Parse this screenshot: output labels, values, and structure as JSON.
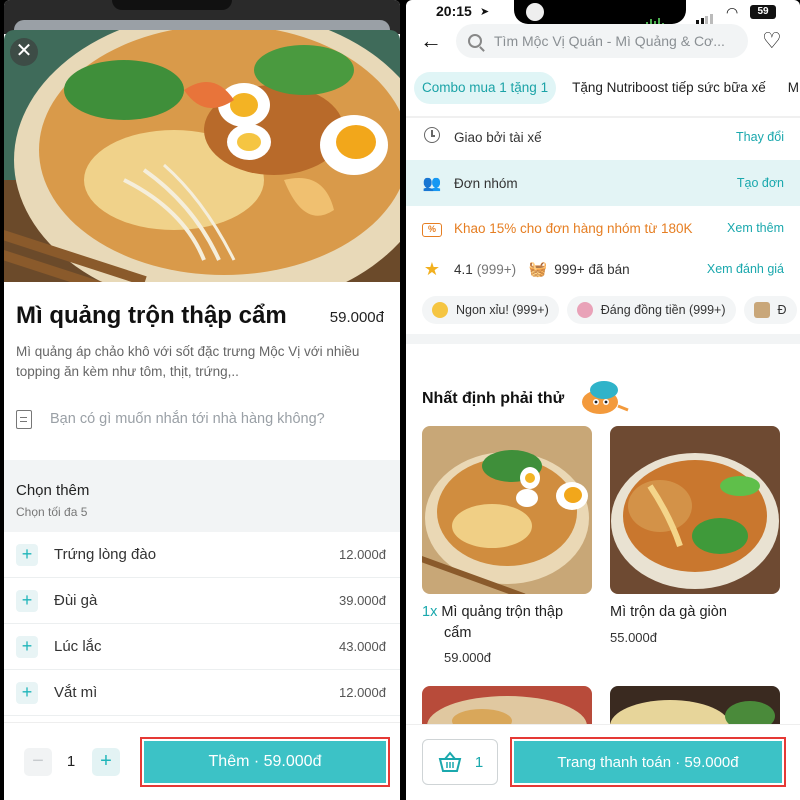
{
  "left": {
    "close_label": "✕",
    "product": {
      "name": "Mì quảng trộn thập cẩm",
      "price": "59.000đ",
      "description": "Mì quảng áp chảo khô với sốt đặc trưng Mộc Vị với nhiều topping ăn kèm như tôm, thịt, trứng,.."
    },
    "note_placeholder": "Bạn có gì muốn nhắn tới nhà hàng không?",
    "addons": {
      "title": "Chọn thêm",
      "subtitle": "Chọn tối đa 5",
      "items": [
        {
          "name": "Trứng lòng đào",
          "price": "12.000đ"
        },
        {
          "name": "Đùi gà",
          "price": "39.000đ"
        },
        {
          "name": "Lúc lắc",
          "price": "43.000đ"
        },
        {
          "name": "Vắt mì",
          "price": "12.000đ"
        }
      ]
    },
    "footer": {
      "minus": "−",
      "quantity": "1",
      "plus": "+",
      "add_button": "Thêm  · 59.000đ"
    }
  },
  "right": {
    "status": {
      "time": "20:15",
      "battery": "59"
    },
    "search_placeholder": "Tìm Mộc Vị Quán - Mì Quảng & Cơ...",
    "chips": [
      "Combo mua 1 tặng 1",
      "Tặng Nutriboost tiếp sức bữa xế",
      "M"
    ],
    "delivery": {
      "text": "Giao bởi tài xế",
      "link": "Thay đổi"
    },
    "group": {
      "text": "Đơn nhóm",
      "link": "Tạo đơn"
    },
    "promo": {
      "icon_text": "%",
      "text": "Khao 15% cho đơn hàng nhóm từ 180K",
      "link": "Xem thêm"
    },
    "rating": {
      "score": "4.1",
      "count": "(999+)",
      "sold": "999+ đã bán",
      "link": "Xem đánh giá"
    },
    "tags": [
      "Ngon xỉu! (999+)",
      "Đáng đồng tiền (999+)",
      "Đ"
    ],
    "section_title": "Nhất định phải thử",
    "dishes": [
      {
        "qty": "1x",
        "name_line1": "Mì quảng trộn thập",
        "name_line2": "cẩm",
        "price": "59.000đ"
      },
      {
        "qty": "",
        "name_line1": "Mì trộn da gà giòn",
        "name_line2": "",
        "price": "55.000đ"
      }
    ],
    "footer": {
      "cart_count": "1",
      "pay_button": "Trang thanh toán · 59.000đ"
    }
  },
  "colors": {
    "accent": "#3cc2c6",
    "accent_text": "#1aa8ad",
    "highlight_border": "#e53935",
    "promo": "#e67e22"
  }
}
